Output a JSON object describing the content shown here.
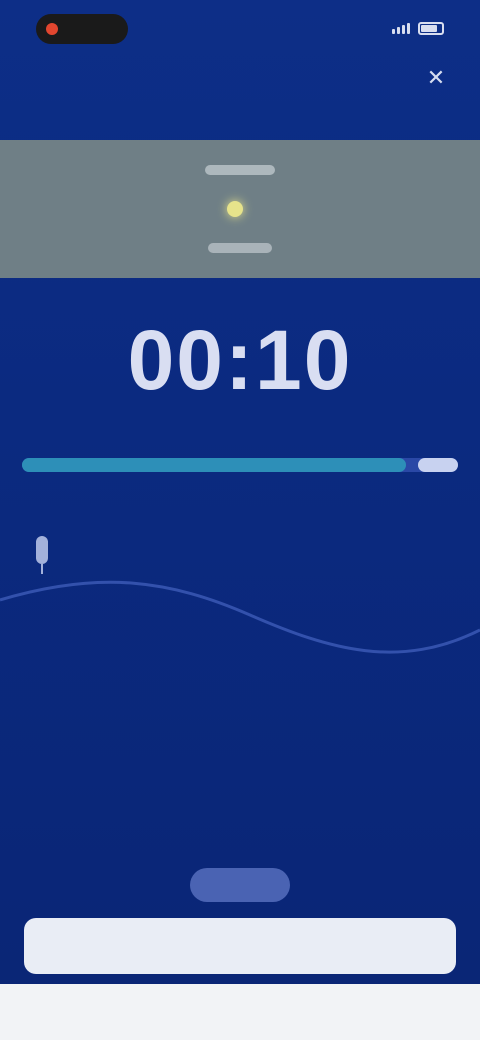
{
  "status_bar": {
    "time": "",
    "signal_icon": "signal-bars-icon",
    "battery_icon": "battery-icon"
  },
  "header": {
    "close_icon": "close-icon",
    "close_symbol": "✕"
  },
  "banner": {
    "title": "",
    "icon": "sun-icon"
  },
  "timer": {
    "value": "00:10",
    "label": ""
  },
  "progress": {
    "fraction": 0.88
  },
  "recording": {
    "mic_icon": "microphone-icon"
  },
  "info": {
    "title": "",
    "text": ""
  },
  "actions": {
    "secondary_label": "",
    "primary_label": ""
  },
  "colors": {
    "background": "#0b2a82",
    "accent": "#2d8fb8",
    "banner": "#6f7f86"
  }
}
